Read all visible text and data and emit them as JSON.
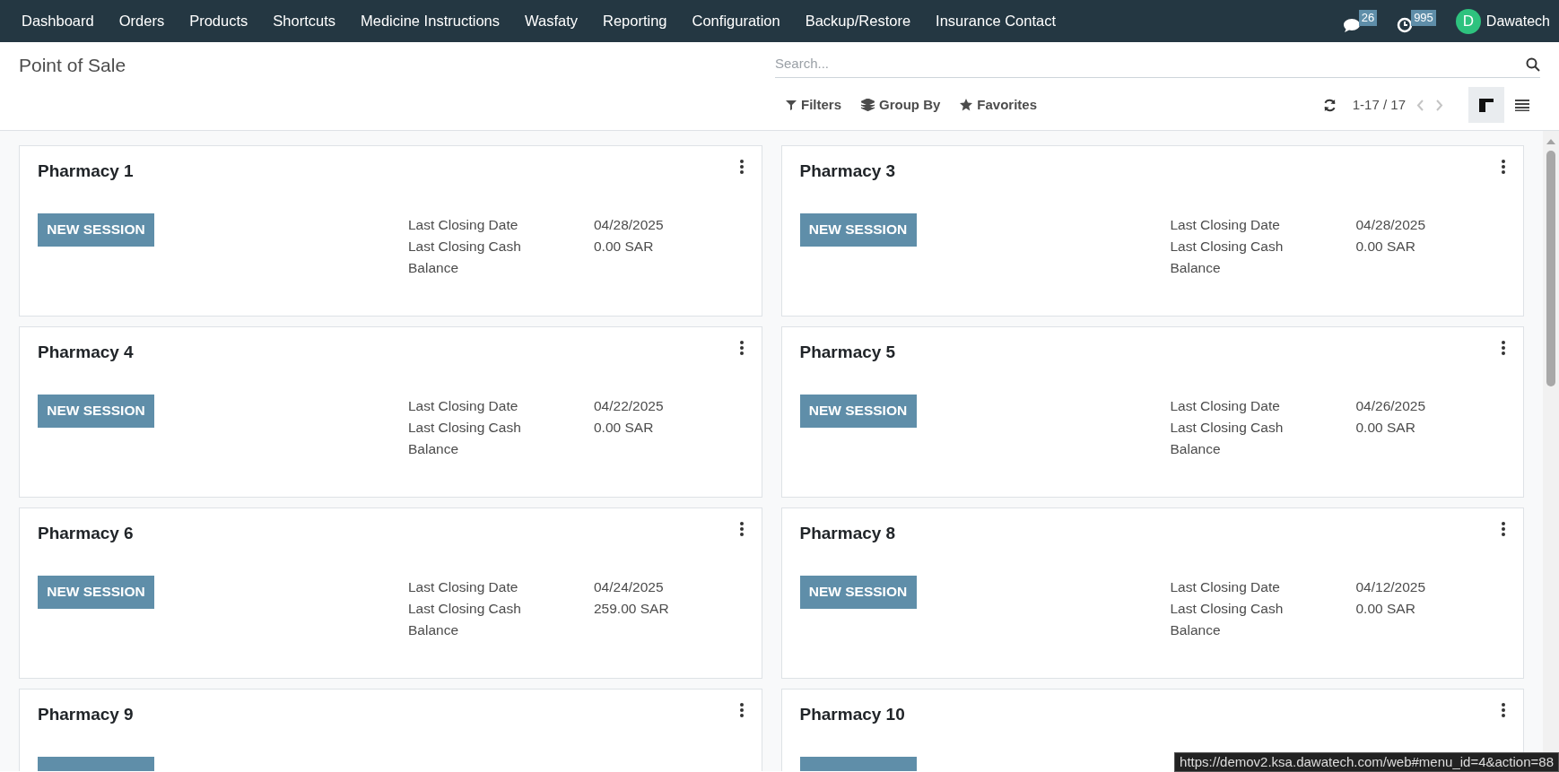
{
  "navbar": {
    "menu": [
      {
        "label": "Dashboard"
      },
      {
        "label": "Orders"
      },
      {
        "label": "Products"
      },
      {
        "label": "Shortcuts"
      },
      {
        "label": "Medicine Instructions"
      },
      {
        "label": "Wasfaty"
      },
      {
        "label": "Reporting"
      },
      {
        "label": "Configuration"
      },
      {
        "label": "Backup/Restore"
      },
      {
        "label": "Insurance Contact"
      }
    ],
    "messages_count": "26",
    "activities_count": "995",
    "user": {
      "initial": "D",
      "name": "Dawatech"
    }
  },
  "control_panel": {
    "title": "Point of Sale",
    "search": {
      "placeholder": "Search..."
    },
    "filters": "Filters",
    "group_by": "Group By",
    "favorites": "Favorites",
    "pager": "1-17 / 17",
    "views": [
      {
        "kind": "kanban",
        "selected": true
      },
      {
        "kind": "list",
        "selected": false
      }
    ]
  },
  "cards": [
    {
      "name": "Pharmacy 1",
      "button": "NEW SESSION",
      "details": [
        {
          "label": "Last Closing Date",
          "value": "04/28/2025"
        },
        {
          "label": "Last Closing Cash Balance",
          "value": "0.00 SAR"
        }
      ]
    },
    {
      "name": "Pharmacy 3",
      "button": "NEW SESSION",
      "details": [
        {
          "label": "Last Closing Date",
          "value": "04/28/2025"
        },
        {
          "label": "Last Closing Cash Balance",
          "value": "0.00 SAR"
        }
      ]
    },
    {
      "name": "Pharmacy 4",
      "button": "NEW SESSION",
      "details": [
        {
          "label": "Last Closing Date",
          "value": "04/22/2025"
        },
        {
          "label": "Last Closing Cash Balance",
          "value": "0.00 SAR"
        }
      ]
    },
    {
      "name": "Pharmacy 5",
      "button": "NEW SESSION",
      "details": [
        {
          "label": "Last Closing Date",
          "value": "04/26/2025"
        },
        {
          "label": "Last Closing Cash Balance",
          "value": "0.00 SAR"
        }
      ]
    },
    {
      "name": "Pharmacy 6",
      "button": "NEW SESSION",
      "details": [
        {
          "label": "Last Closing Date",
          "value": "04/24/2025"
        },
        {
          "label": "Last Closing Cash Balance",
          "value": "259.00 SAR"
        }
      ]
    },
    {
      "name": "Pharmacy 8",
      "button": "NEW SESSION",
      "details": [
        {
          "label": "Last Closing Date",
          "value": "04/12/2025"
        },
        {
          "label": "Last Closing Cash Balance",
          "value": "0.00 SAR"
        }
      ]
    },
    {
      "name": "Pharmacy 9"
    },
    {
      "name": "Pharmacy 10"
    }
  ],
  "status_bar": {
    "url": "https://demov2.ksa.dawatech.com/web#menu_id=4&action=88"
  }
}
